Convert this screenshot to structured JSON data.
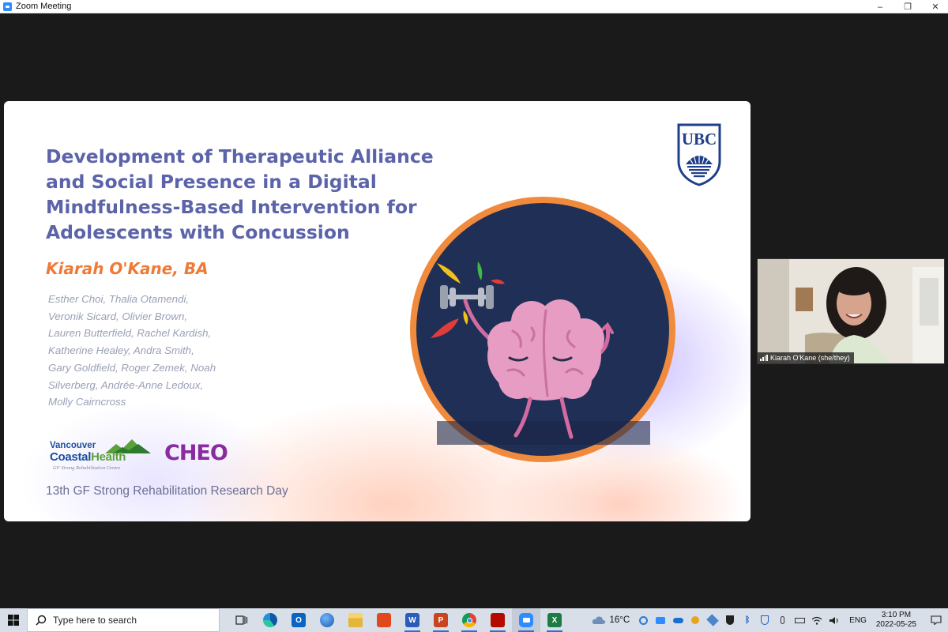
{
  "window": {
    "title": "Zoom Meeting",
    "minimize": "–",
    "restore": "❐",
    "close": "✕"
  },
  "slide": {
    "title": "Development of Therapeutic Alliance and Social Presence in a Digital Mindfulness-Based Intervention for Adolescents with Concussion",
    "presenter": "Kiarah O'Kane, BA",
    "coauthors": "Esther Choi, Thalia Otamendi, Veronik Sicard, Olivier Brown, Lauren Butterfield, Rachel Kardish, Katherine Healey, Andra Smith, Gary Goldfield, Roger Zemek, Noah Silverberg, Andrée-Anne Ledoux, Molly Cairncross",
    "logo_vch_line1": "Vancouver",
    "logo_vch_line2a": "Coastal",
    "logo_vch_line2b": "Health",
    "logo_vch_line3": "GF Strong Rehabilitation Centre",
    "logo_cheo": "CHEO",
    "logo_ubc": "UBC",
    "event": "13th GF Strong Rehabilitation Research Day",
    "colors": {
      "title": "#5b63a9",
      "presenter": "#ef7a37",
      "illustration_ring": "#f08a3c",
      "illustration_bg": "#1f2f55"
    }
  },
  "participant": {
    "name": "Kiarah O'Kane (she/they)"
  },
  "taskbar": {
    "search_placeholder": "Type here to search",
    "apps": [
      {
        "name": "task-view",
        "icon": "task-view-icon"
      },
      {
        "name": "edge",
        "icon": "edge-icon"
      },
      {
        "name": "outlook",
        "icon": "outlook-icon",
        "label": "O"
      },
      {
        "name": "globe",
        "icon": "globe-icon"
      },
      {
        "name": "file-explorer",
        "icon": "folder-icon"
      },
      {
        "name": "office",
        "icon": "office-icon"
      },
      {
        "name": "word",
        "icon": "word-icon",
        "label": "W"
      },
      {
        "name": "powerpoint",
        "icon": "powerpoint-icon",
        "label": "P"
      },
      {
        "name": "chrome",
        "icon": "chrome-icon"
      },
      {
        "name": "acrobat",
        "icon": "acrobat-icon"
      },
      {
        "name": "zoom",
        "icon": "zoom-icon"
      },
      {
        "name": "excel",
        "icon": "excel-icon",
        "label": "X"
      }
    ],
    "weather_temp": "16°C",
    "language": "ENG",
    "time": "3:10 PM",
    "date": "2022-05-25"
  }
}
